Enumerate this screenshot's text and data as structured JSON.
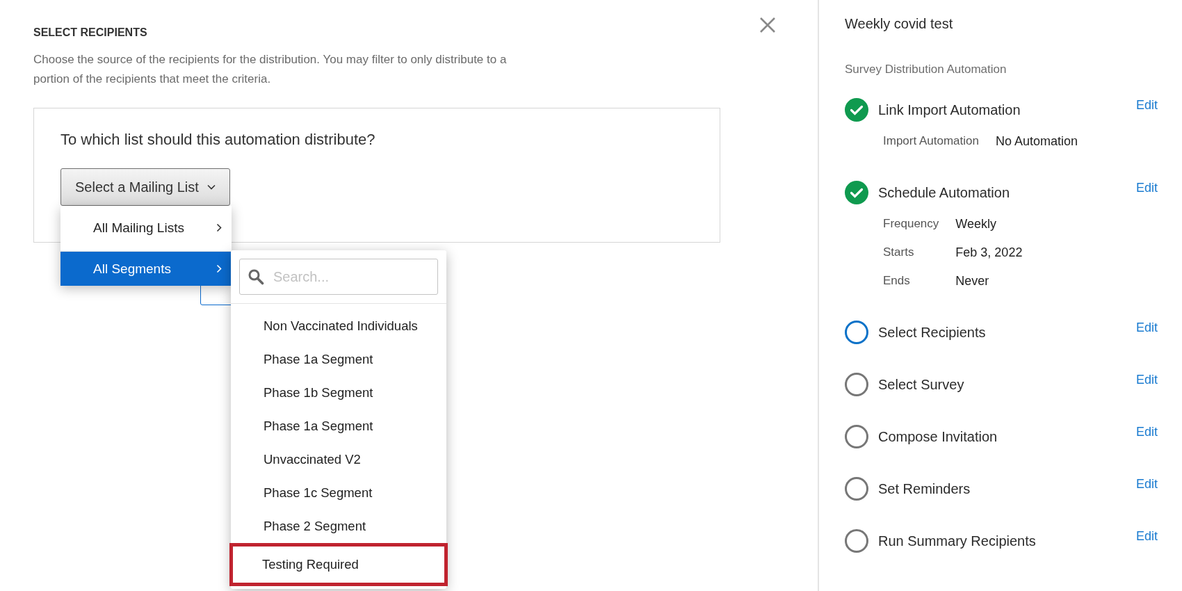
{
  "dialog": {
    "heading": "SELECT RECIPIENTS",
    "description": "Choose the source of the recipients for the distribution. You may filter to only distribute to a portion of the recipients that meet the criteria.",
    "question": "To which list should this automation distribute?",
    "dropdown": {
      "label": "Select a Mailing List",
      "expanded": true
    },
    "menu": [
      {
        "label": "All Mailing Lists",
        "selected": false
      },
      {
        "label": "All Segments",
        "selected": true
      }
    ],
    "submenu": {
      "search": {
        "placeholder": "Search..."
      },
      "items": [
        {
          "label": "Non Vaccinated Individuals",
          "highlighted": false
        },
        {
          "label": "Phase 1a Segment",
          "highlighted": false
        },
        {
          "label": "Phase 1b Segment",
          "highlighted": false
        },
        {
          "label": "Phase 1a Segment",
          "highlighted": false
        },
        {
          "label": "Unvaccinated V2",
          "highlighted": false
        },
        {
          "label": "Phase 1c Segment",
          "highlighted": false
        },
        {
          "label": "Phase 2 Segment",
          "highlighted": false
        },
        {
          "label": "Testing Required",
          "highlighted": true
        }
      ]
    }
  },
  "sidebar": {
    "title": "Weekly covid test",
    "subtitle": "Survey Distribution Automation",
    "steps": [
      {
        "title": "Link Import Automation",
        "kind": "complete",
        "edit": "Edit",
        "details": [
          {
            "label": "Import Automation",
            "value": "No Automation"
          }
        ]
      },
      {
        "title": "Schedule Automation",
        "kind": "complete",
        "edit": "Edit",
        "details": [
          {
            "label": "Frequency",
            "value": "Weekly"
          },
          {
            "label": "Starts",
            "value": "Feb 3, 2022"
          },
          {
            "label": "Ends",
            "value": "Never"
          }
        ]
      },
      {
        "title": "Select Recipients",
        "kind": "current",
        "edit": "Edit"
      },
      {
        "title": "Select Survey",
        "kind": "pending",
        "edit": "Edit"
      },
      {
        "title": "Compose Invitation",
        "kind": "pending",
        "edit": "Edit"
      },
      {
        "title": "Set Reminders",
        "kind": "pending",
        "edit": "Edit"
      },
      {
        "title": "Run Summary Recipients",
        "kind": "pending",
        "edit": "Edit"
      }
    ]
  }
}
